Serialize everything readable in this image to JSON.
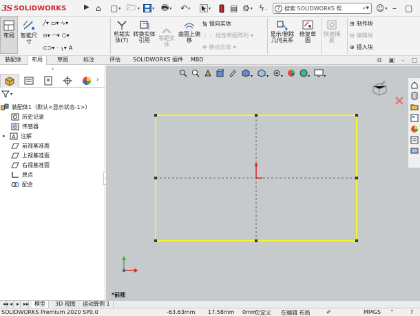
{
  "app": {
    "logo_text": "SOLIDWORKS",
    "logo_mark": "3S",
    "search_placeholder": "搜索 SOLIDWORKS 帮"
  },
  "quick_access": [
    "home-icon",
    "new-document-icon",
    "open-icon",
    "save-icon",
    "print-icon",
    "undo-icon",
    "select-arrow-icon",
    "traffic-light-icon",
    "file-properties-icon",
    "options-icon",
    "customize-icon",
    "help-icon",
    "user-icon"
  ],
  "ribbon": {
    "layout_label": "布局",
    "smart_dims_label": "智能尺寸",
    "cut_entities_label": "剪裁实体(T)",
    "convert_entities_label": "转换实体引用",
    "offset_entities_label": "等距实体",
    "surface_offset_label": "曲面上偏移",
    "mirror_label": "镜向实体",
    "linear_pattern_label": "线性草图阵列",
    "move_entities_label": "移动实体",
    "show_hide_label": "显示/删除几何关系",
    "repair_label": "修复草图",
    "quick_snap_label": "快速捕捉",
    "make_block_label": "制作块",
    "edit_block_label": "编辑块",
    "insert_block_label": "插入块"
  },
  "tabs": [
    "装配体",
    "布局",
    "草图",
    "标注",
    "评估",
    "SOLIDWORKS 插件",
    "MBD"
  ],
  "active_tab": "布局",
  "tree": {
    "root": "装配体1（默认<显示状态-1>）",
    "items": [
      "历史记录",
      "传感器",
      "注解",
      "前视基准面",
      "上视基准面",
      "右视基准面",
      "原点",
      "配合"
    ]
  },
  "graphics": {
    "view_label": "*前视"
  },
  "bottom_tabs": [
    "模型",
    "3D 视图",
    "运动算例 1"
  ],
  "active_bottom_tab": "模型",
  "status": {
    "product": "SOLIDWORKS Premium 2020 SP0.0",
    "x": "-63.63mm",
    "y": "17.58mm",
    "z": "0mm",
    "state": "欠定义",
    "editing": "在编辑 布局",
    "units": "MMGS"
  },
  "colors": {
    "sketch_rect": "#ffff00",
    "canvas_bg": "#c6cacc",
    "origin": "#e02020",
    "brand": "#d0272f"
  }
}
